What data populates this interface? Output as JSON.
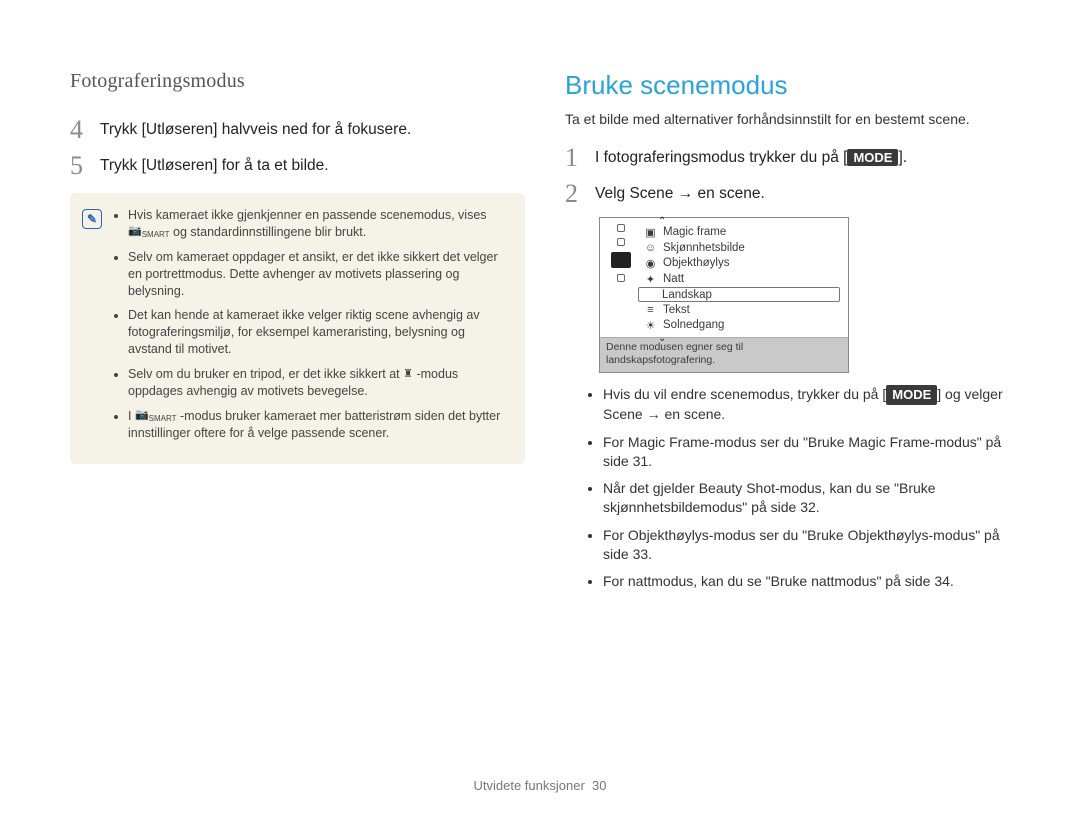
{
  "section_title": "Fotograferingsmodus",
  "left": {
    "step4": {
      "num": "4",
      "text": "Trykk [Utløseren] halvveis ned for å fokusere."
    },
    "step5": {
      "num": "5",
      "text": "Trykk [Utløseren] for å ta et bilde."
    },
    "notes": [
      "Hvis kameraet ikke gjenkjenner en passende scenemodus, vises ",
      "Selv om kameraet oppdager et ansikt, er det ikke sikkert det velger en portrettmodus. Dette avhenger av motivets plassering og belysning.",
      "Det kan hende at kameraet ikke velger riktig scene avhengig av fotograferingsmiljø, for eksempel kameraristing, belysning og avstand til motivet.",
      "Selv om du bruker en tripod, er det ikke sikkert at ",
      "I "
    ],
    "note1_suffix": " og standardinnstillingene blir brukt.",
    "note4_suffix": "-modus oppdages avhengig av motivets bevegelse.",
    "note5_suffix": "-modus bruker kameraet mer batteristrøm siden det bytter innstillinger oftere for å velge passende scener."
  },
  "right": {
    "heading": "Bruke scenemodus",
    "intro": "Ta et bilde med alternativer forhåndsinnstilt for en bestemt scene.",
    "step1": {
      "num": "1",
      "text_pre": "I fotograferingsmodus trykker du på [",
      "mode": "MODE",
      "text_post": "]."
    },
    "step2": {
      "num": "2",
      "text": "Velg Scene → en scene."
    },
    "scene_items": [
      {
        "glyph": "▣",
        "label": "Magic frame"
      },
      {
        "glyph": "☺",
        "label": "Skjønnhetsbilde"
      },
      {
        "glyph": "◉",
        "label": "Objekthøylys"
      },
      {
        "glyph": "✦",
        "label": "Natt"
      },
      {
        "glyph": "",
        "label": "Landskap",
        "selected": true
      },
      {
        "glyph": "≡",
        "label": "Tekst"
      },
      {
        "glyph": "☀",
        "label": "Solnedgang"
      }
    ],
    "scene_caption": "Denne modusen egner seg til landskapsfotografering.",
    "bullets_b1_pre": "Hvis du vil endre scenemodus, trykker du på [",
    "bullets_b1_mode": "MODE",
    "bullets_b1_post": "] og velger Scene → en scene.",
    "bullets_b2": "For Magic Frame-modus ser du \"Bruke Magic Frame-modus\" på side 31.",
    "bullets_b3": "Når det gjelder Beauty Shot-modus, kan du se \"Bruke skjønnhetsbildemodus\" på side 32.",
    "bullets_b4": "For Objekthøylys-modus ser du \"Bruke Objekthøylys-modus\" på side 33.",
    "bullets_b5": "For nattmodus, kan du se \"Bruke nattmodus\" på side 34."
  },
  "footer": {
    "label": "Utvidete funksjoner",
    "page": "30"
  }
}
